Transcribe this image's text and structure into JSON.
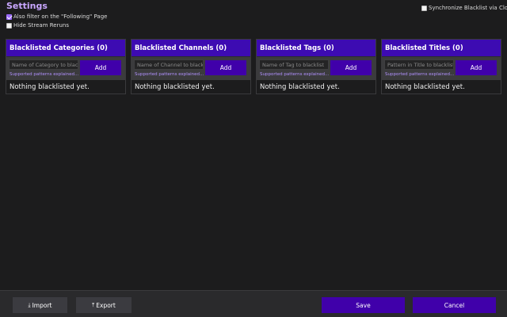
{
  "title": "Settings",
  "options": {
    "filter_following": {
      "label": "Also filter on the \"Following\" Page",
      "checked": true
    },
    "hide_reruns": {
      "label": "Hide Stream Reruns",
      "checked": false
    },
    "sync_cloud": {
      "label": "Synchronize Blacklist via Cloud",
      "checked": false
    }
  },
  "cards": [
    {
      "title": "Blacklisted Categories (0)",
      "placeholder": "Name of Category to blacklist",
      "patterns_link": "Supported patterns explained...",
      "add_label": "Add",
      "empty": "Nothing blacklisted yet."
    },
    {
      "title": "Blacklisted Channels (0)",
      "placeholder": "Name of Channel to blacklist",
      "patterns_link": "Supported patterns explained...",
      "add_label": "Add",
      "empty": "Nothing blacklisted yet."
    },
    {
      "title": "Blacklisted Tags (0)",
      "placeholder": "Name of Tag to blacklist",
      "patterns_link": "Supported patterns explained...",
      "add_label": "Add",
      "empty": "Nothing blacklisted yet."
    },
    {
      "title": "Blacklisted Titles (0)",
      "placeholder": "Pattern in Title to blacklist",
      "patterns_link": "Supported patterns explained...",
      "add_label": "Add",
      "empty": "Nothing blacklisted yet."
    }
  ],
  "footer": {
    "import_label": "Import",
    "import_icon": "⤓",
    "export_label": "Export",
    "export_icon": "⤒",
    "save_label": "Save",
    "cancel_label": "Cancel"
  },
  "colors": {
    "accent": "#4000aa",
    "header": "#3d0bb2",
    "title": "#c9a7ff",
    "link": "#b292ff",
    "background": "#1c1c1d"
  }
}
